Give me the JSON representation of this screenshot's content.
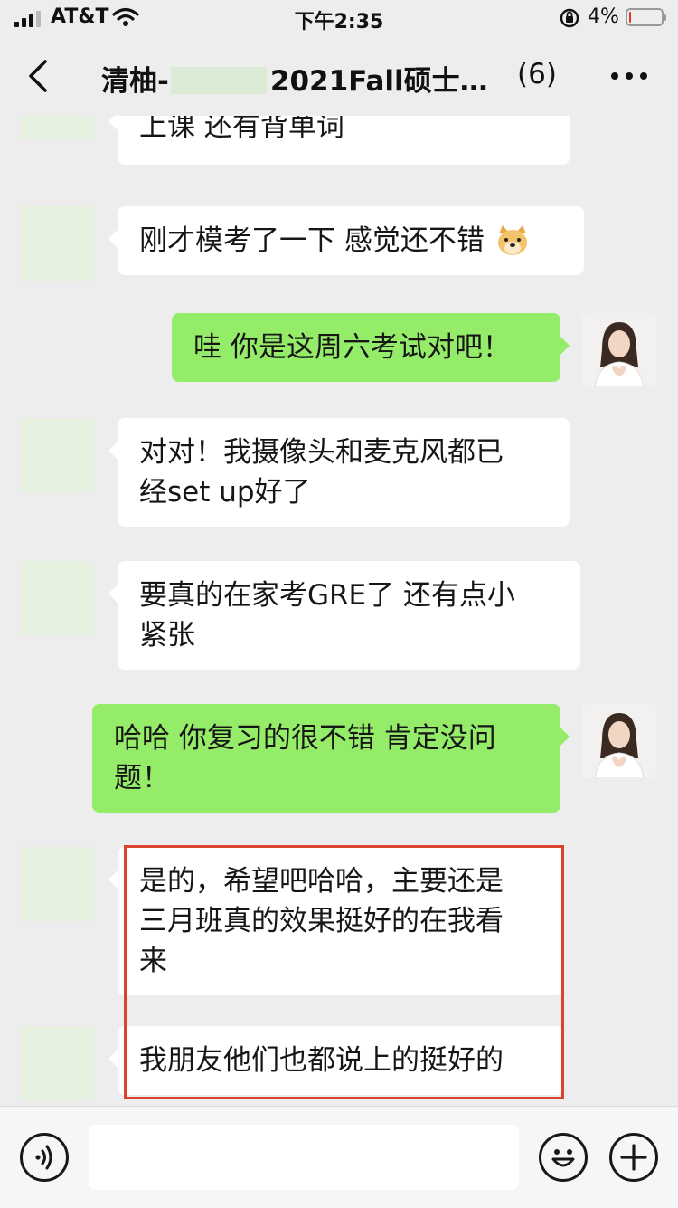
{
  "status_bar": {
    "carrier": "AT&T",
    "time": "下午2:35",
    "battery": "4%",
    "battery_level": 0.04
  },
  "nav": {
    "title_prefix": "清柚-",
    "title_suffix": "2021Fall硕士…",
    "member_count": "(6)"
  },
  "messages": [
    {
      "side": "left",
      "text_lines": [
        "上课 还有背单词"
      ]
    },
    {
      "side": "left",
      "text_lines": [
        "刚才模考了一下 感觉还不错"
      ],
      "emoji": "doge-emoji"
    },
    {
      "side": "right",
      "text_lines": [
        "哇 你是这周六考试对吧！"
      ]
    },
    {
      "side": "left",
      "text_lines": [
        "对对！我摄像头和麦克风都已",
        "经set up好了"
      ]
    },
    {
      "side": "left",
      "text_lines": [
        "要真的在家考GRE了 还有点小",
        "紧张"
      ]
    },
    {
      "side": "right",
      "text_lines": [
        "哈哈 你复习的很不错 肯定没问",
        "题！"
      ]
    },
    {
      "side": "left",
      "text_lines": [
        "是的，希望吧哈哈，主要还是",
        "三月班真的效果挺好的在我看",
        "来"
      ]
    },
    {
      "side": "left",
      "text_lines": [
        "我朋友他们也都说上的挺好的"
      ]
    }
  ],
  "colors": {
    "chat_background": "#ededed",
    "self_bubble": "#95ec69",
    "other_bubble": "#ffffff",
    "highlight_border": "#d9432f"
  },
  "icons": [
    "signal-icon",
    "wifi-icon",
    "orientation-lock-icon",
    "battery-icon",
    "back-icon",
    "more-icon",
    "voice-icon",
    "emoji-icon",
    "add-icon"
  ]
}
